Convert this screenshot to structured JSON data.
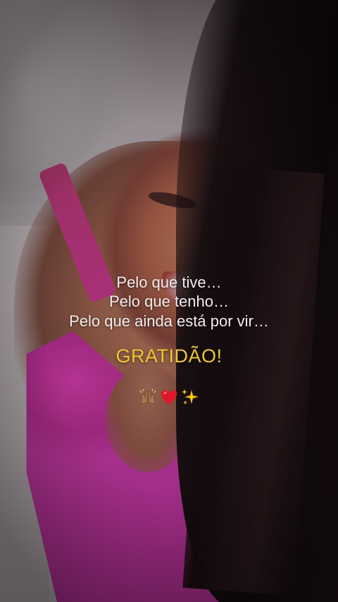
{
  "caption": {
    "line1": "Pelo que tive…",
    "line2": "Pelo que tenho…",
    "line3": "Pelo que ainda está por vir…"
  },
  "headline": "GRATIDÃO!",
  "emojis": [
    "raised-hands-icon",
    "red-heart-icon",
    "sparkles-icon"
  ],
  "colors": {
    "caption_text": "#f4ecee",
    "headline_text": "#f0c832",
    "garment": "#d23cb0"
  }
}
